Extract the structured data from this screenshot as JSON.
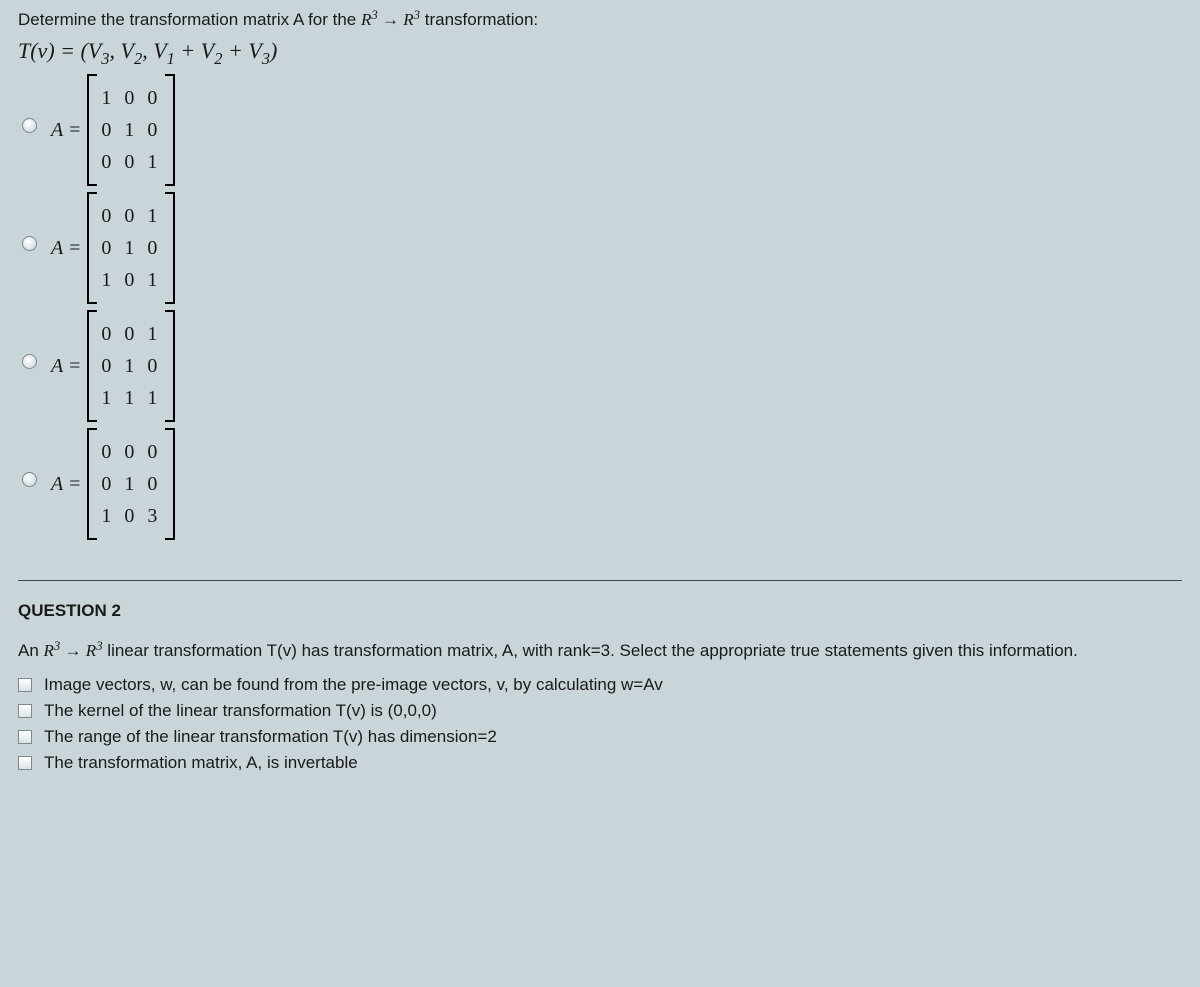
{
  "q1": {
    "prompt_pre": "Determine the transformation matrix A for the ",
    "prompt_math": "R³ → R³",
    "prompt_post": " transformation:",
    "formula": "T(v) = (V₃, V₂, V₁ + V₂ + V₃)",
    "options": [
      {
        "label": "A =",
        "rows": [
          "1 0 0",
          "0 1 0",
          "0 0 1"
        ]
      },
      {
        "label": "A =",
        "rows": [
          "0 0 1",
          "0 1 0",
          "1 0 1"
        ]
      },
      {
        "label": "A =",
        "rows": [
          "0 0 1",
          "0 1 0",
          "1 1 1"
        ]
      },
      {
        "label": "A =",
        "rows": [
          "0 0 0",
          "0 1 0",
          "1 0 3"
        ]
      }
    ]
  },
  "q2": {
    "title": "QUESTION 2",
    "prompt_pre": "An ",
    "prompt_math": "R³ → R³",
    "prompt_post": " linear transformation T(v) has transformation matrix, A, with rank=3. Select the appropriate true statements given this information.",
    "checks": [
      "Image vectors, w, can be found from the pre-image vectors, v, by calculating w=Av",
      "The kernel of the linear transformation T(v) is (0,0,0)",
      "The range of the linear transformation T(v) has dimension=2",
      "The transformation matrix, A, is invertable"
    ]
  }
}
